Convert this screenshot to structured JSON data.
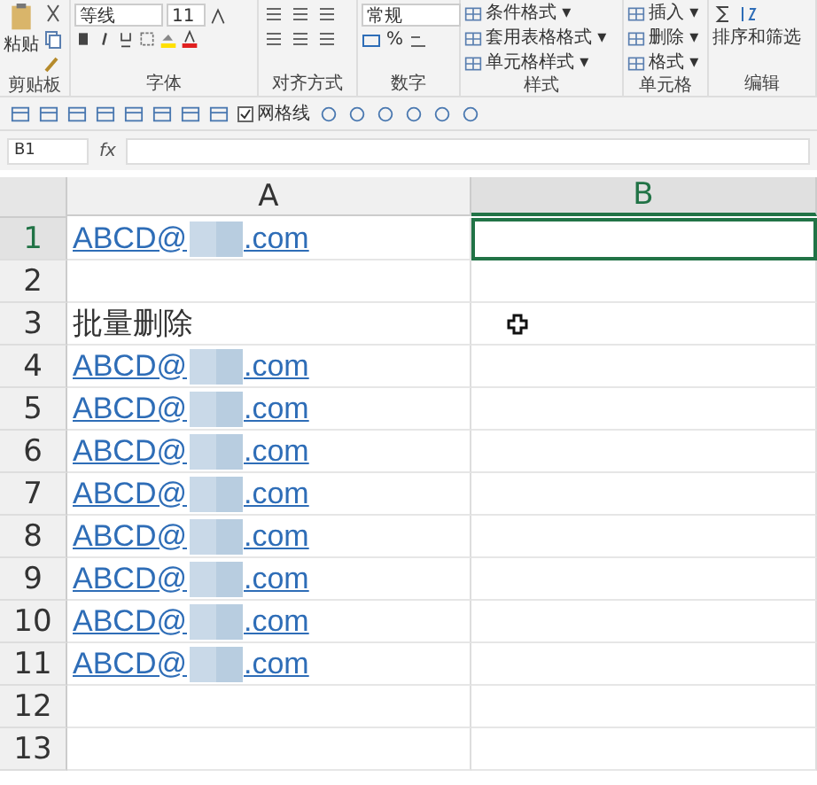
{
  "ribbon": {
    "groups": [
      {
        "kind": "clipboard",
        "label": "剪贴板",
        "paste": "粘贴"
      },
      {
        "kind": "font",
        "label": "字体",
        "font_name": "等线",
        "font_size": "11"
      },
      {
        "kind": "alignment",
        "label": "对齐方式"
      },
      {
        "kind": "number",
        "label": "数字",
        "format": "常规",
        "percent": "%"
      },
      {
        "kind": "styles",
        "label": "样式",
        "items": [
          "条件格式 ▾",
          "套用表格格式 ▾",
          "单元格样式 ▾"
        ]
      },
      {
        "kind": "cells",
        "label": "单元格",
        "items": [
          "插入 ▾",
          "删除 ▾",
          "格式 ▾"
        ]
      },
      {
        "kind": "editing",
        "label": "编辑",
        "sort": "排序和筛选"
      }
    ]
  },
  "quick_toolbar": {
    "gridlines": {
      "label": "网格线",
      "checked": true
    }
  },
  "formula_bar": {
    "name_box": "B1",
    "fx": "fx"
  },
  "sheet": {
    "columns": [
      {
        "label": "A",
        "selected": false
      },
      {
        "label": "B",
        "selected": true
      }
    ],
    "rows": [
      {
        "number": "1",
        "kind": "link",
        "text": "ABCD@",
        "suffix": ".com",
        "redacted": true,
        "b_selected": true
      },
      {
        "number": "2",
        "kind": "empty",
        "b_selected": false
      },
      {
        "number": "3",
        "kind": "text",
        "text": "批量删除",
        "b_selected": false
      },
      {
        "number": "4",
        "kind": "link",
        "text": "ABCD@",
        "suffix": ".com",
        "redacted": true,
        "b_selected": false
      },
      {
        "number": "5",
        "kind": "link",
        "text": "ABCD@",
        "suffix": ".com",
        "redacted": true,
        "b_selected": false
      },
      {
        "number": "6",
        "kind": "link",
        "text": "ABCD@",
        "suffix": ".com",
        "redacted": true,
        "b_selected": false
      },
      {
        "number": "7",
        "kind": "link",
        "text": "ABCD@",
        "suffix": ".com",
        "redacted": true,
        "b_selected": false
      },
      {
        "number": "8",
        "kind": "link",
        "text": "ABCD@",
        "suffix": ".com",
        "redacted": true,
        "b_selected": false
      },
      {
        "number": "9",
        "kind": "link",
        "text": "ABCD@",
        "suffix": ".com",
        "redacted": true,
        "b_selected": false
      },
      {
        "number": "10",
        "kind": "link",
        "text": "ABCD@",
        "suffix": ".com",
        "redacted": true,
        "b_selected": false
      },
      {
        "number": "11",
        "kind": "link",
        "text": "ABCD@",
        "suffix": ".com",
        "redacted": true,
        "b_selected": false
      },
      {
        "number": "12",
        "kind": "empty",
        "b_selected": false
      },
      {
        "number": "13",
        "kind": "empty",
        "b_selected": false
      }
    ]
  }
}
